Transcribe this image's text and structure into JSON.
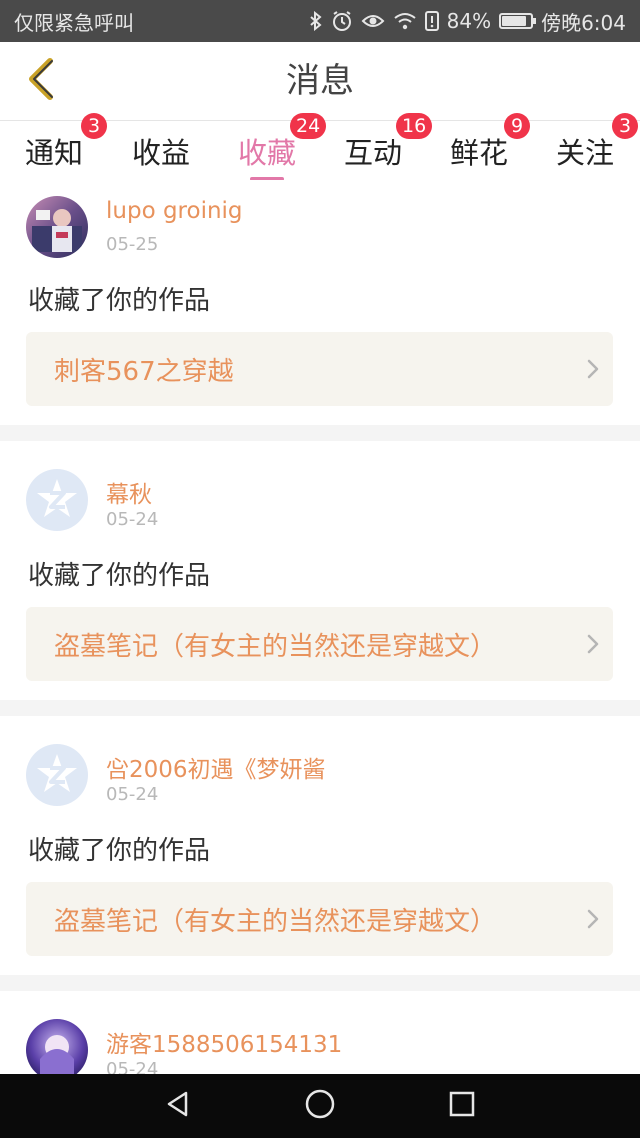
{
  "status_bar": {
    "carrier": "仅限紧急呼叫",
    "battery_percent": "84%",
    "battery_level": 0.84,
    "time": "傍晚6:04",
    "icons": [
      "bluetooth-icon",
      "alarm-icon",
      "eye-icon",
      "wifi-icon",
      "sim-alert-icon",
      "battery-icon"
    ]
  },
  "header": {
    "title": "消息",
    "back_icon": "chevron-left-icon"
  },
  "tabs": [
    {
      "label": "通知",
      "badge": "3"
    },
    {
      "label": "收益",
      "badge": ""
    },
    {
      "label": "收藏",
      "badge": "24",
      "active": true
    },
    {
      "label": "互动",
      "badge": "16"
    },
    {
      "label": "鲜花",
      "badge": "9"
    },
    {
      "label": "关注",
      "badge": "3"
    }
  ],
  "messages": [
    {
      "username": "lupo groinig",
      "date": "05-25",
      "action": "收藏了你的作品",
      "work_title": "刺客567之穿越",
      "avatar": "photo"
    },
    {
      "username": "幕秋",
      "date": "05-24",
      "action": "收藏了你的作品",
      "work_title": "盗墓笔记（有女主的当然还是穿越文）",
      "avatar": "default"
    },
    {
      "username": "吢2006初遇《梦妍酱",
      "date": "05-24",
      "action": "收藏了你的作品",
      "work_title": "盗墓笔记（有女主的当然还是穿越文）",
      "avatar": "default"
    },
    {
      "username": "游客1588506154131",
      "date": "05-24",
      "action": "",
      "work_title": "",
      "avatar": "photo"
    }
  ],
  "colors": {
    "accent_pink": "#e278a8",
    "accent_orange": "#e8925c",
    "badge_red": "#f0344a",
    "back_gold": "#c9a227"
  }
}
